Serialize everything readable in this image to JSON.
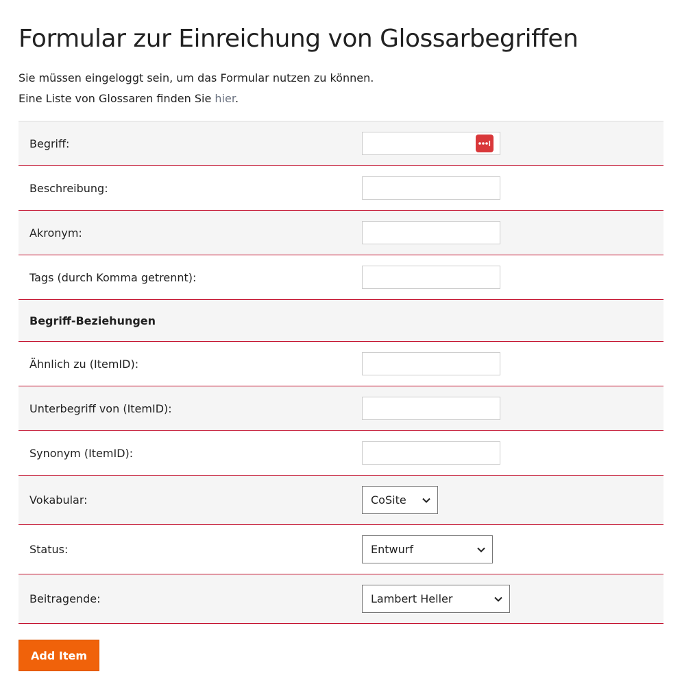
{
  "page": {
    "title": "Formular zur Einreichung von Glossarbegriffen",
    "intro_line1": "Sie müssen eingeloggt sein, um das Formular nutzen zu können.",
    "intro_line2_prefix": "Eine Liste von Glossaren finden Sie ",
    "intro_line2_link": "hier",
    "intro_line2_suffix": "."
  },
  "form": {
    "term_label": "Begriff:",
    "description_label": "Beschreibung:",
    "acronym_label": "Akronym:",
    "tags_label": "Tags (durch Komma getrennt):",
    "relations_heading": "Begriff-Beziehungen",
    "similar_label": "Ähnlich zu (ItemID):",
    "subterm_label": "Unterbegriff von (ItemID):",
    "synonym_label": "Synonym (ItemID):",
    "vocabulary_label": "Vokabular:",
    "vocabulary_value": "CoSite",
    "status_label": "Status:",
    "status_value": "Entwurf",
    "contributors_label": "Beitragende:",
    "contributors_value": "Lambert Heller",
    "term_value": "",
    "description_value": "",
    "acronym_value": "",
    "tags_value": "",
    "similar_value": "",
    "subterm_value": "",
    "synonym_value": ""
  },
  "actions": {
    "submit_label": "Add Item"
  },
  "colors": {
    "accent": "#f0620a",
    "link": "#6b7280",
    "row_shade": "#f5f5f5",
    "password_icon": "#d9383a"
  }
}
